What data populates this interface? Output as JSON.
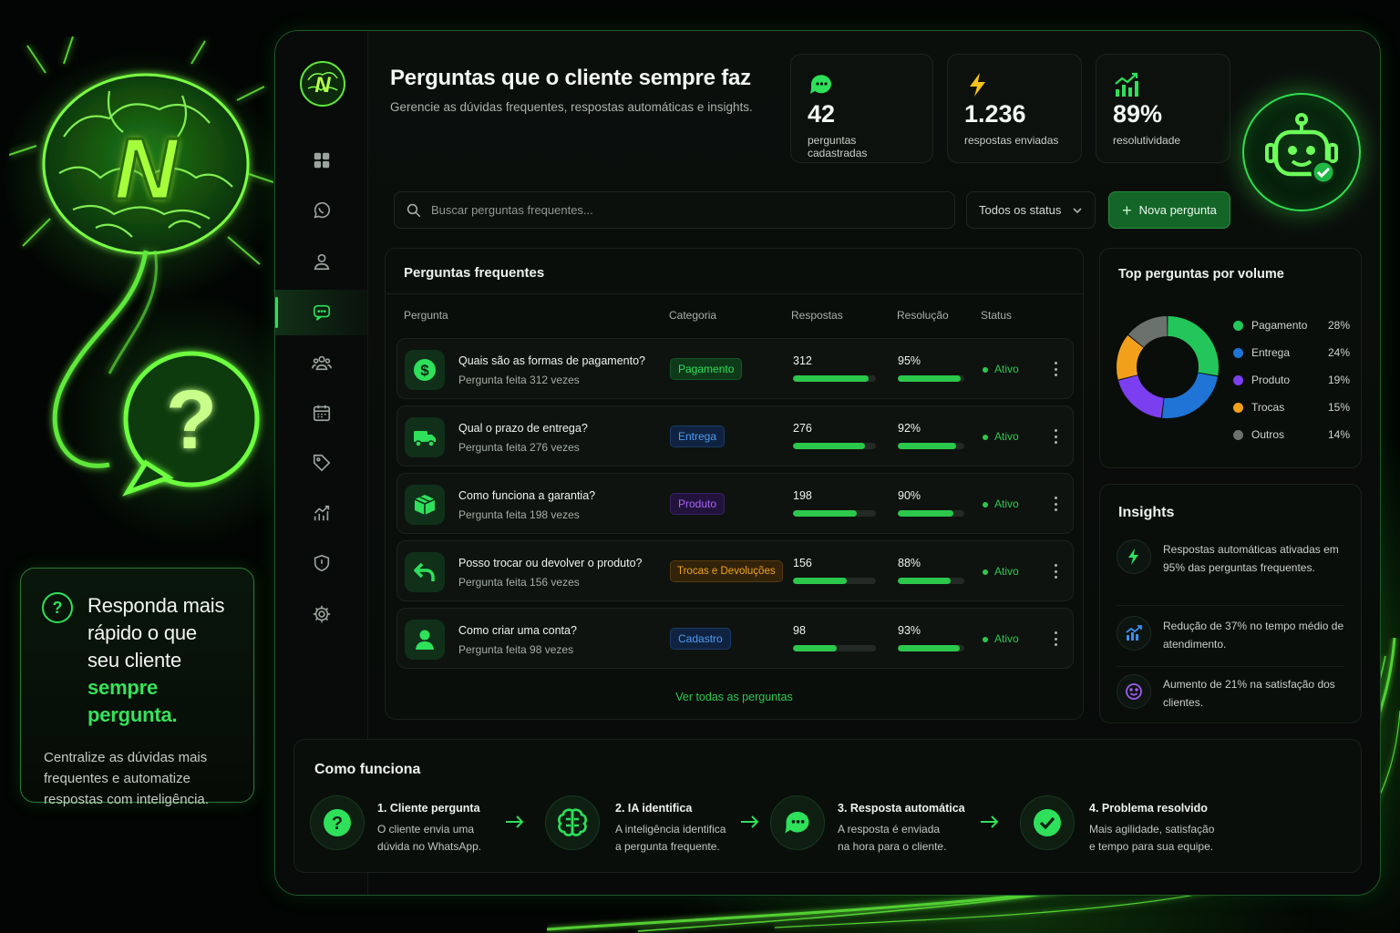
{
  "hero": {
    "icon_text": "?",
    "title_line1": "Responda mais",
    "title_line2": "rápido o que",
    "title_line3": "seu cliente",
    "title_accent": "sempre pergunta.",
    "text": "Centralize as dúvidas mais frequentes e automatize respostas com inteligência."
  },
  "brand": {
    "logo_letter": "N"
  },
  "page": {
    "title": "Perguntas que o cliente sempre faz",
    "subtitle": "Gerencie as dúvidas frequentes, respostas automáticas e insights."
  },
  "sidebar": {
    "items": [
      {
        "name": "dashboard",
        "icon": "grid-icon"
      },
      {
        "name": "whatsapp",
        "icon": "whatsapp-icon"
      },
      {
        "name": "contacts",
        "icon": "user-icon"
      },
      {
        "name": "faq",
        "icon": "chat-icon",
        "active": true
      },
      {
        "name": "team",
        "icon": "users-icon"
      },
      {
        "name": "calendar",
        "icon": "calendar-icon"
      },
      {
        "name": "tags",
        "icon": "tag-icon"
      },
      {
        "name": "reports",
        "icon": "chart-icon"
      },
      {
        "name": "security",
        "icon": "shield-icon"
      },
      {
        "name": "settings",
        "icon": "gear-icon"
      }
    ]
  },
  "stats": [
    {
      "value": "42",
      "label": "perguntas cadastradas",
      "icon": "chat-bubble-icon",
      "color": "#2ee05a"
    },
    {
      "value": "1.236",
      "label": "respostas enviadas",
      "icon": "lightning-icon",
      "color": "#f4c21c"
    },
    {
      "value": "89%",
      "label": "resolutividade",
      "icon": "trend-chart-icon",
      "color": "#2ee05a"
    }
  ],
  "search": {
    "placeholder": "Buscar perguntas frequentes..."
  },
  "filter": {
    "selected": "Todos os status"
  },
  "new_button": {
    "label": "Nova pergunta"
  },
  "faq": {
    "title": "Perguntas frequentes",
    "columns": {
      "question": "Pergunta",
      "category": "Categoria",
      "responses": "Respostas",
      "resolution": "Resolução",
      "status": "Status"
    },
    "rows": [
      {
        "question": "Quais são as formas de pagamento?",
        "sub": "Pergunta feita 312 vezes",
        "category": "Pagamento",
        "cat_color": "#2ee05a",
        "responses": "312",
        "resp_pct": 0.91,
        "resolution": "95%",
        "res_pct": 0.95,
        "status": "Ativo",
        "icon": "dollar-icon"
      },
      {
        "question": "Qual o prazo de entrega?",
        "sub": "Pergunta feita 276 vezes",
        "category": "Entrega",
        "cat_color": "#3d8ff0",
        "responses": "276",
        "resp_pct": 0.87,
        "resolution": "92%",
        "res_pct": 0.88,
        "status": "Ativo",
        "icon": "truck-icon"
      },
      {
        "question": "Como funciona a garantia?",
        "sub": "Pergunta feita 198 vezes",
        "category": "Produto",
        "cat_color": "#a25cf2",
        "responses": "198",
        "resp_pct": 0.77,
        "resolution": "90%",
        "res_pct": 0.84,
        "status": "Ativo",
        "icon": "box-icon"
      },
      {
        "question": "Posso trocar ou devolver o produto?",
        "sub": "Pergunta feita 156 vezes",
        "category": "Trocas e Devoluções",
        "cat_color": "#f0a020",
        "responses": "156",
        "resp_pct": 0.65,
        "resolution": "88%",
        "res_pct": 0.79,
        "status": "Ativo",
        "icon": "return-arrow-icon"
      },
      {
        "question": "Como criar uma conta?",
        "sub": "Pergunta feita 98 vezes",
        "category": "Cadastro",
        "cat_color": "#3d8ff0",
        "responses": "98",
        "resp_pct": 0.53,
        "resolution": "93%",
        "res_pct": 0.93,
        "status": "Ativo",
        "icon": "user-icon"
      }
    ],
    "see_all": "Ver todas as perguntas"
  },
  "top": {
    "title": "Top perguntas por volume",
    "chart_data": {
      "type": "pie",
      "title": "Top perguntas por volume",
      "categories": [
        "Pagamento",
        "Entrega",
        "Produto",
        "Trocas",
        "Outros"
      ],
      "values": [
        28,
        24,
        19,
        15,
        14
      ],
      "labels": [
        "28%",
        "24%",
        "19%",
        "15%",
        "14%"
      ],
      "colors": [
        "#22c65a",
        "#1f74d6",
        "#7c3ff0",
        "#f2a01c",
        "#6b716d"
      ],
      "legend": "right"
    }
  },
  "insights": {
    "title": "Insights",
    "items": [
      {
        "text": "Respostas automáticas ativadas em 95% das perguntas frequentes.",
        "icon": "lightning-icon"
      },
      {
        "text": "Redução de 37% no tempo médio de atendimento.",
        "icon": "bar-chart-icon"
      },
      {
        "text": "Aumento de 21% na satisfação dos clientes.",
        "icon": "smile-icon"
      }
    ]
  },
  "how": {
    "title": "Como funciona",
    "steps": [
      {
        "title": "1. Cliente pergunta",
        "line1": "O cliente envia uma",
        "line2": "dúvida no WhatsApp.",
        "icon": "question-icon"
      },
      {
        "title": "2. IA identifica",
        "line1": "A inteligência identifica",
        "line2": "a pergunta frequente.",
        "icon": "brain-icon"
      },
      {
        "title": "3. Resposta automática",
        "line1": "A resposta é enviada",
        "line2": "na hora para o cliente.",
        "icon": "chat-bubble-icon"
      },
      {
        "title": "4. Problema resolvido",
        "line1": "Mais agilidade, satisfação",
        "line2": "e tempo para sua equipe.",
        "icon": "check-circle-icon"
      }
    ]
  }
}
